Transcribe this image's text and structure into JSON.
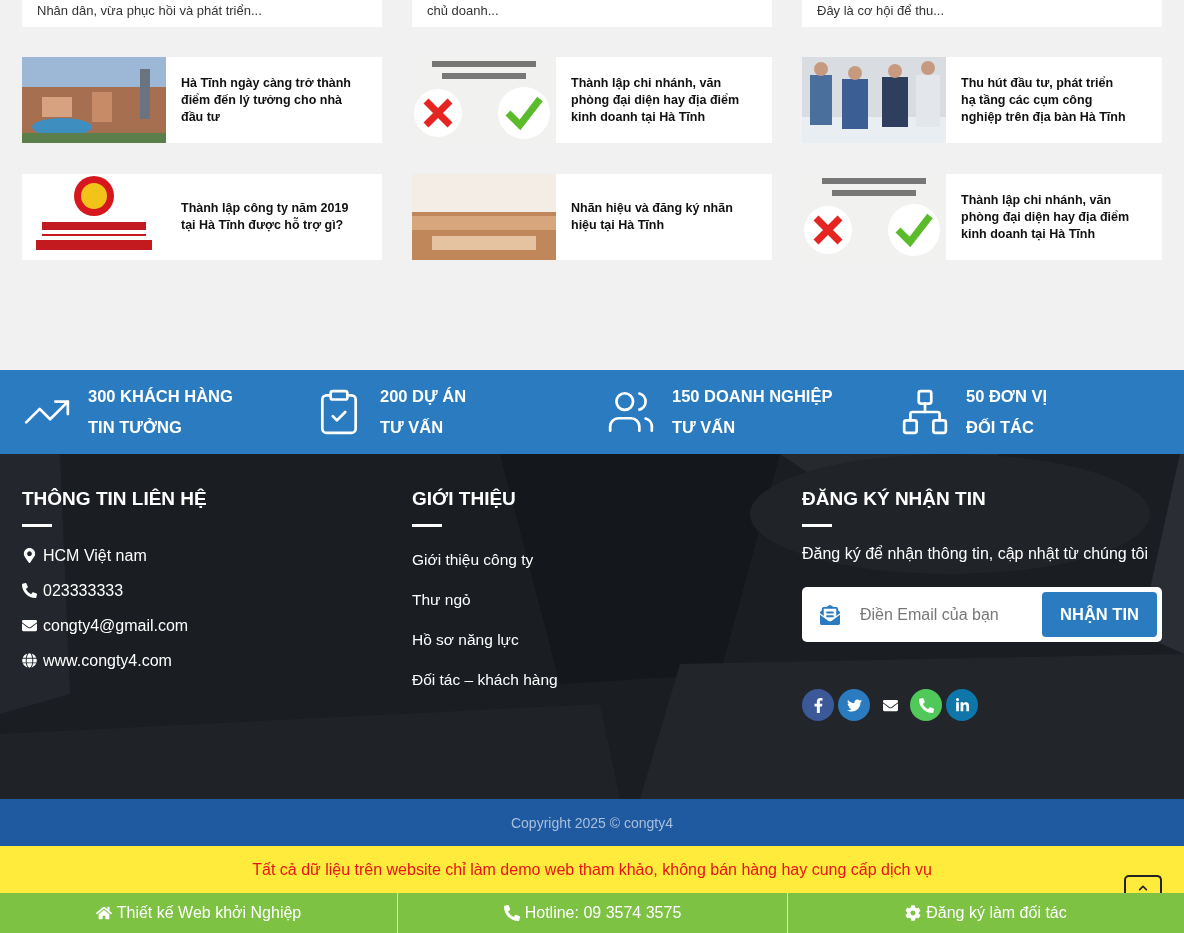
{
  "top_cards": [
    {
      "excerpt": "Nhân dân, vừa phục hồi và phát triển..."
    },
    {
      "excerpt": "chủ doanh..."
    },
    {
      "excerpt": "Đây là cơ hội để thu..."
    }
  ],
  "related_posts": [
    {
      "title": "Hà Tĩnh ngày càng trở thành điểm đến lý tưởng cho nhà đầu tư"
    },
    {
      "title": "Thành lập chi nhánh, văn phòng đại diện hay địa điểm kinh doanh tại Hà Tĩnh"
    },
    {
      "title": "Thu hút đầu tư, phát triển hạ tầng các cụm công nghiệp trên địa bàn Hà Tĩnh"
    },
    {
      "title": "Thành lập công ty năm 2019 tại Hà Tĩnh được hỗ trợ gì?"
    },
    {
      "title": "Nhãn hiệu và đăng ký nhãn hiệu tại Hà Tĩnh"
    },
    {
      "title": "Thành lập chi nhánh, văn phòng đại diện hay địa điểm kinh doanh tại Hà Tĩnh"
    }
  ],
  "stats": [
    {
      "kind": "growth",
      "line1": "300 KHÁCH HÀNG",
      "line2": "TIN TƯỞNG"
    },
    {
      "kind": "clipboard",
      "line1": "200 DỰ ÁN",
      "line2": "TƯ VẤN"
    },
    {
      "kind": "people",
      "line1": "150 DOANH NGHIỆP",
      "line2": "TƯ VẤN"
    },
    {
      "kind": "network",
      "line1": "50 ĐƠN VỊ",
      "line2": "ĐỐI TÁC"
    }
  ],
  "footer": {
    "contact": {
      "heading": "THÔNG TIN LIÊN HỆ",
      "items": [
        {
          "kind": "location",
          "text": "HCM Việt nam"
        },
        {
          "kind": "phone",
          "text": "023333333"
        },
        {
          "kind": "email",
          "text": "congty4@gmail.com"
        },
        {
          "kind": "web",
          "text": "www.congty4.com"
        }
      ]
    },
    "about": {
      "heading": "GIỚI THIỆU",
      "links": [
        "Giới thiệu công ty",
        "Thư ngỏ",
        "Hồ sơ năng lực",
        "Đối tác – khách hàng"
      ]
    },
    "newsletter": {
      "heading": "ĐĂNG KÝ NHẬN TIN",
      "text": "Đăng ký để nhận thông tin, cập nhật từ chúng tôi",
      "placeholder": "Điền Email của bạn",
      "button": "NHẬN TIN"
    },
    "social": [
      {
        "kind": "facebook"
      },
      {
        "kind": "twitter"
      },
      {
        "kind": "email"
      },
      {
        "kind": "phone"
      },
      {
        "kind": "linkedin"
      }
    ]
  },
  "copyright": "Copyright 2025 © congty4",
  "notice": "Tất cả dữ liệu trên website chỉ làm demo web tham khảo, không bán hàng hay cung cấp dịch vụ",
  "bottom_bar": [
    {
      "kind": "home",
      "text": "Thiết kế Web khởi Nghiệp"
    },
    {
      "kind": "phone",
      "text": "Hotline: 09 3574 3575"
    },
    {
      "kind": "settings",
      "text": "Đăng ký làm đối tác"
    }
  ]
}
